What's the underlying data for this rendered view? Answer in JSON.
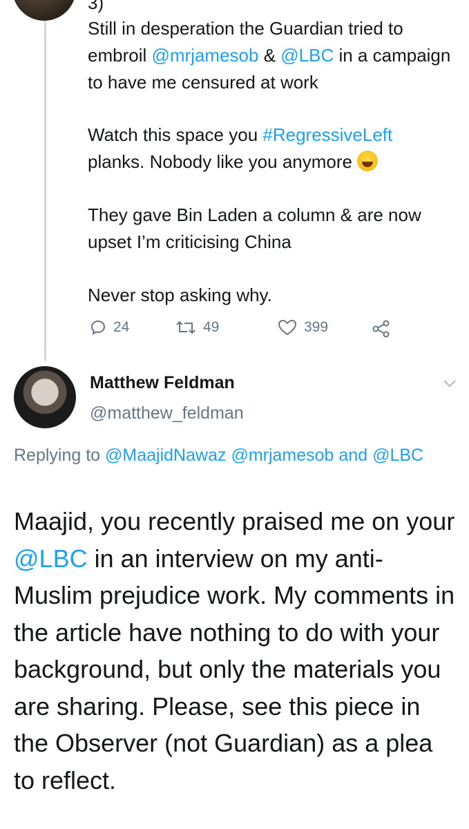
{
  "previous_tweet": {
    "cut_text": "3)",
    "para1": {
      "t1": "Still in desperation the Guardian tried to embroil ",
      "m1": "@mrjamesob",
      "t2": " & ",
      "m2": "@LBC",
      "t3": " in a campaign to have me censured at work"
    },
    "para2": {
      "t1": "Watch this space you ",
      "hashtag": "#RegressiveLeft",
      "t2": " planks. Nobody like you anymore "
    },
    "para3": "They gave Bin Laden a column & are now upset I’m criticising China",
    "para4": "Never stop asking why.",
    "actions": {
      "replies": "24",
      "retweets": "49",
      "likes": "399"
    }
  },
  "reply_tweet": {
    "name": "Matthew Feldman",
    "handle": "@matthew_feldman",
    "replying_prefix": "Replying to ",
    "replying_m1": "@MaajidNawaz",
    "replying_m2": "@mrjamesob",
    "replying_and": " and",
    "replying_m3": "@LBC",
    "body_t1": "Maajid, you recently praised me on your ",
    "body_mention": "@LBC",
    "body_t2": " in an interview on my anti-Muslim prejudice work. My comments in the article have nothing to do with your background, but only the materials you are sharing. Please, see this piece in the Observer (not Guardian) as a plea to reflect."
  },
  "colors": {
    "link": "#1da1f2",
    "secondary": "#657786",
    "text": "#14171a",
    "thread_line": "#ccd6dd"
  },
  "icons": [
    "reply-icon",
    "retweet-icon",
    "like-icon",
    "share-icon",
    "chevron-down-icon"
  ]
}
